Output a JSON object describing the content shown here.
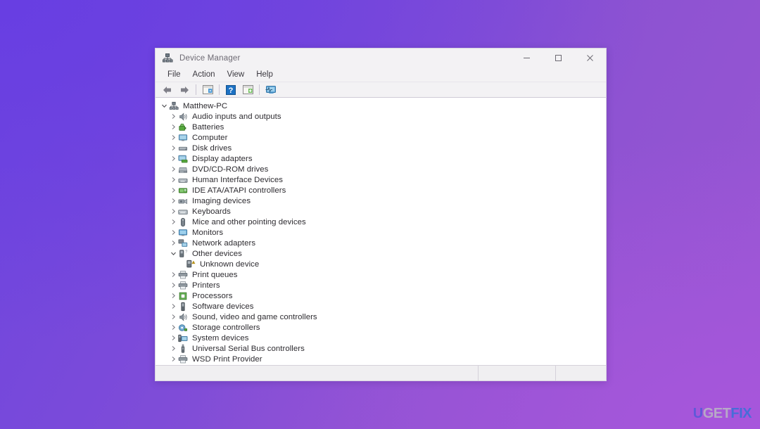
{
  "background": {
    "gradient_from": "#6d45de",
    "gradient_mid": "#8c52d2",
    "gradient_to": "#9a57d3"
  },
  "window": {
    "title": "Device Manager",
    "title_icon": "device-manager-icon",
    "controls": {
      "minimize": "minimize-icon",
      "maximize": "maximize-icon",
      "close": "close-icon"
    }
  },
  "menubar": {
    "items": [
      {
        "label": "File"
      },
      {
        "label": "Action"
      },
      {
        "label": "View"
      },
      {
        "label": "Help"
      }
    ]
  },
  "toolbar": {
    "buttons": [
      {
        "name": "back-icon",
        "title": "Back"
      },
      {
        "name": "forward-icon",
        "title": "Forward"
      },
      {
        "name": "show-hide-console-tree-icon",
        "title": "Show/Hide Console Tree"
      },
      {
        "name": "help-icon",
        "title": "Help"
      },
      {
        "name": "properties-icon",
        "title": "Properties"
      },
      {
        "name": "scan-for-hardware-changes-icon",
        "title": "Scan for hardware changes"
      }
    ]
  },
  "tree": {
    "root": {
      "label": "Matthew-PC",
      "icon": "computer-root-icon",
      "expanded": true,
      "level": 0
    },
    "items": [
      {
        "label": "Audio inputs and outputs",
        "icon": "speaker-icon",
        "expanded": false,
        "level": 1
      },
      {
        "label": "Batteries",
        "icon": "battery-icon",
        "expanded": false,
        "level": 1
      },
      {
        "label": "Computer",
        "icon": "monitor-icon",
        "expanded": false,
        "level": 1
      },
      {
        "label": "Disk drives",
        "icon": "disk-drive-icon",
        "expanded": false,
        "level": 1
      },
      {
        "label": "Display adapters",
        "icon": "display-adapter-icon",
        "expanded": false,
        "level": 1
      },
      {
        "label": "DVD/CD-ROM drives",
        "icon": "optical-drive-icon",
        "expanded": false,
        "level": 1
      },
      {
        "label": "Human Interface Devices",
        "icon": "hid-icon",
        "expanded": false,
        "level": 1
      },
      {
        "label": "IDE ATA/ATAPI controllers",
        "icon": "ide-controller-icon",
        "expanded": false,
        "level": 1
      },
      {
        "label": "Imaging devices",
        "icon": "camera-icon",
        "expanded": false,
        "level": 1
      },
      {
        "label": "Keyboards",
        "icon": "keyboard-icon",
        "expanded": false,
        "level": 1
      },
      {
        "label": "Mice and other pointing devices",
        "icon": "mouse-icon",
        "expanded": false,
        "level": 1
      },
      {
        "label": "Monitors",
        "icon": "monitor-icon",
        "expanded": false,
        "level": 1
      },
      {
        "label": "Network adapters",
        "icon": "network-adapter-icon",
        "expanded": false,
        "level": 1
      },
      {
        "label": "Other devices",
        "icon": "other-devices-icon",
        "expanded": true,
        "level": 1
      },
      {
        "label": "Unknown device",
        "icon": "unknown-device-warning-icon",
        "expanded": null,
        "level": 2
      },
      {
        "label": "Print queues",
        "icon": "printer-queue-icon",
        "expanded": false,
        "level": 1
      },
      {
        "label": "Printers",
        "icon": "printer-icon",
        "expanded": false,
        "level": 1
      },
      {
        "label": "Processors",
        "icon": "processor-icon",
        "expanded": false,
        "level": 1
      },
      {
        "label": "Software devices",
        "icon": "software-device-icon",
        "expanded": false,
        "level": 1
      },
      {
        "label": "Sound, video and game controllers",
        "icon": "sound-controller-icon",
        "expanded": false,
        "level": 1
      },
      {
        "label": "Storage controllers",
        "icon": "storage-controller-icon",
        "expanded": false,
        "level": 1
      },
      {
        "label": "System devices",
        "icon": "system-device-icon",
        "expanded": false,
        "level": 1
      },
      {
        "label": "Universal Serial Bus controllers",
        "icon": "usb-controller-icon",
        "expanded": false,
        "level": 1
      },
      {
        "label": "WSD Print Provider",
        "icon": "printer-queue-icon",
        "expanded": false,
        "level": 1
      }
    ]
  },
  "statusbar": {
    "main_text": "",
    "pane_two_text": "",
    "pane_three_text": ""
  },
  "watermark": {
    "part1": "U",
    "part2": "GET",
    "part3": "FIX",
    "color1": "#5a5ad8",
    "color2": "#b9b0c6",
    "color3": "#3f6fd8"
  }
}
